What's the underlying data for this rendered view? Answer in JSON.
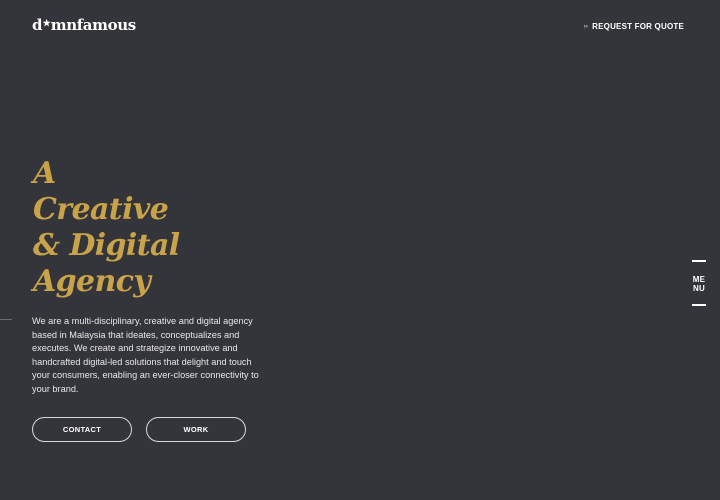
{
  "header": {
    "logo_left": "d",
    "logo_star": "★",
    "logo_right": "mnfamous",
    "request_arrow": "››",
    "request_label": "REQUEST FOR QUOTE"
  },
  "hero": {
    "title_lines": [
      "A",
      "Creative",
      "& Digital",
      "Agency"
    ],
    "description": "We are a multi-disciplinary, creative and digital agency based in Malaysia that ideates, conceptualizes and executes. We create and strategize innovative and handcrafted digital-led solutions that delight and touch your consumers, enabling an ever-closer connectivity to your brand.",
    "buttons": {
      "contact": "CONTACT",
      "work": "WORK"
    }
  },
  "menu": {
    "label_line1": "ME",
    "label_line2": "NU"
  },
  "colors": {
    "background": "#34353a",
    "accent_gold": "#c8a349",
    "text_white": "#ffffff"
  }
}
